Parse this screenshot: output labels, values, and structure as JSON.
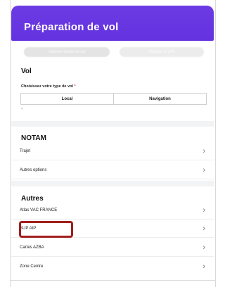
{
  "header": {
    "title": "Préparation de vol"
  },
  "actions": {
    "left_label": "Imprimer dossier de vol",
    "right_label": "Préparer le VFR"
  },
  "vol": {
    "title": "Vol",
    "flight_type_label": "Choisissez votre type de vol",
    "required_mark": "*",
    "options": [
      "Local",
      "Navigation"
    ],
    "dropdown_hint": "▾"
  },
  "notam": {
    "title": "NOTAM",
    "items": [
      {
        "label": "Trajet"
      },
      {
        "label": "Autres options"
      }
    ]
  },
  "autres": {
    "title": "Autres",
    "items": [
      {
        "label": "Atlas VAC FRANCE"
      },
      {
        "label": "SUP AIP"
      },
      {
        "label": "Cartes AZBA"
      },
      {
        "label": "Zone Centre"
      }
    ]
  },
  "colors": {
    "header_bg": "#6432df",
    "highlight": "#a11d1d",
    "required": "#dd3333"
  }
}
